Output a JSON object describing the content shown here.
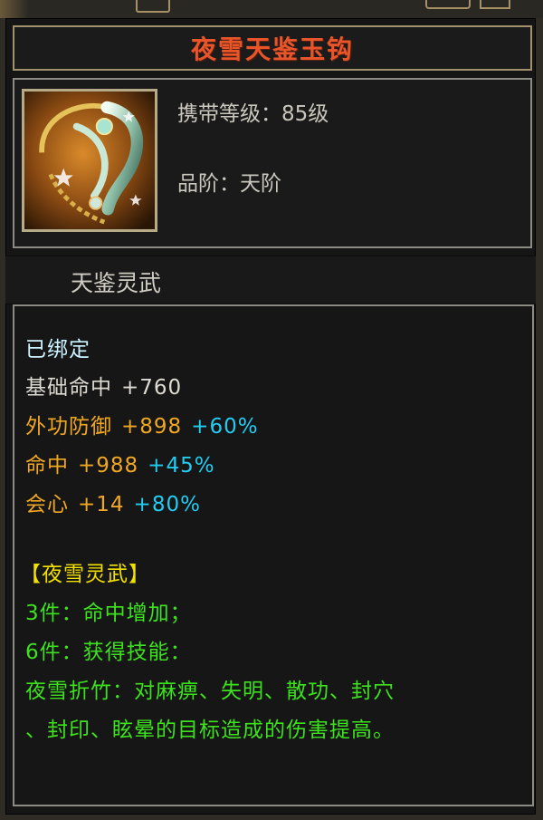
{
  "item": {
    "name": "夜雪天鉴玉钩",
    "level_req": "携带等级：85级",
    "grade": "品阶：天阶",
    "category": "天鉴灵武",
    "icon": "jade-hook-weapon-icon"
  },
  "stats": {
    "bound": "已绑定",
    "base": {
      "label": "基础命中",
      "value": "+760"
    },
    "attrs": [
      {
        "label": "外功防御",
        "value": "+898",
        "bonus": "+60%"
      },
      {
        "label": "命中",
        "value": "+988",
        "bonus": "+45%"
      },
      {
        "label": "会心",
        "value": "+14",
        "bonus": "+80%"
      }
    ]
  },
  "set": {
    "title": "【夜雪灵武】",
    "effects": [
      "3件：命中增加；",
      "6件：获得技能：",
      "夜雪折竹：对麻痹、失明、散功、封穴",
      "、封印、眩晕的目标造成的伤害提高。"
    ]
  },
  "colors": {
    "title": "#e9552a",
    "bound": "#ccf2ff",
    "attr_label": "#f0a722",
    "bonus": "#23ccf2",
    "set_title": "#f2e000",
    "set_text": "#3de21e"
  }
}
